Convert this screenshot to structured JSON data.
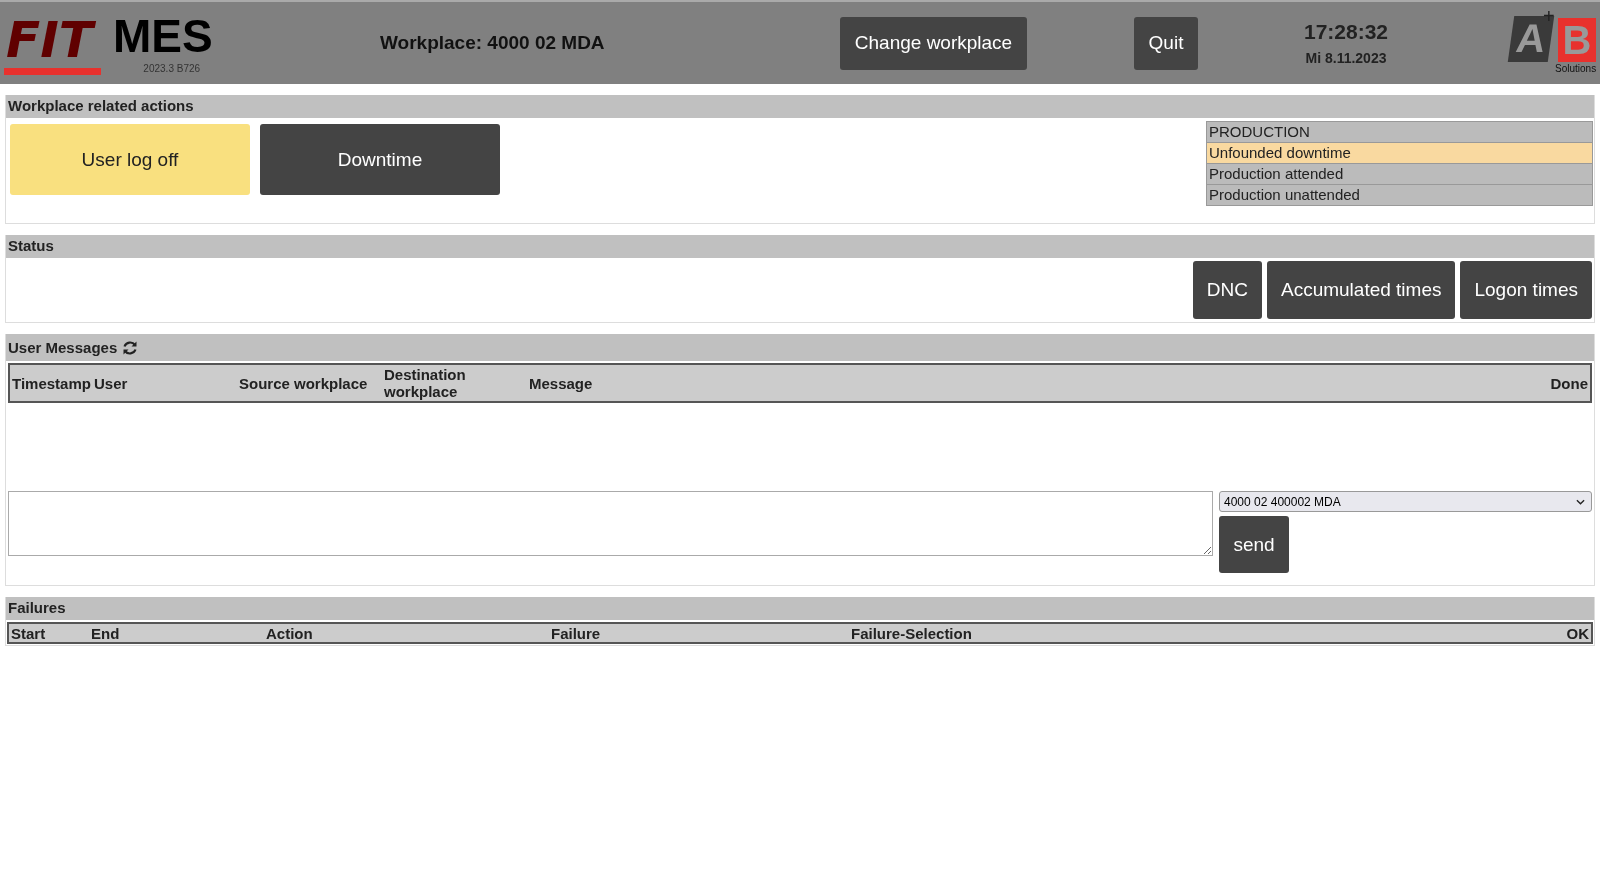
{
  "header": {
    "logo": {
      "mark": "FIT",
      "name": "MES",
      "version": "2023.3 B726"
    },
    "workplace": "Workplace: 4000 02 MDA",
    "buttons": [
      "Change workplace",
      "Quit"
    ],
    "time": "17:28:32",
    "date": "Mi 8.11.2023",
    "brand": {
      "a": "A",
      "plus": "+",
      "b": "B",
      "tagline": "Solutions"
    }
  },
  "workplace_actions": {
    "title": "Workplace related actions",
    "buttons": [
      {
        "label": "User log off",
        "kind": "highlight"
      },
      {
        "label": "Downtime",
        "kind": "dark"
      }
    ],
    "production": {
      "title": "PRODUCTION",
      "items": [
        {
          "label": "Unfounded downtime",
          "selected": true
        },
        {
          "label": "Production attended",
          "selected": false
        },
        {
          "label": "Production unattended",
          "selected": false
        }
      ]
    }
  },
  "status": {
    "title": "Status",
    "buttons": [
      "DNC",
      "Accumulated times",
      "Logon times"
    ]
  },
  "user_messages": {
    "title": "User Messages",
    "columns": [
      "Timestamp",
      "User",
      "Source workplace",
      "Destination workplace",
      "Message",
      "Done"
    ],
    "destination": "4000 02 400002 MDA",
    "send": "send"
  },
  "failures": {
    "title": "Failures",
    "columns": [
      "Start",
      "End",
      "Action",
      "Failure",
      "Failure-Selection",
      "OK"
    ]
  }
}
